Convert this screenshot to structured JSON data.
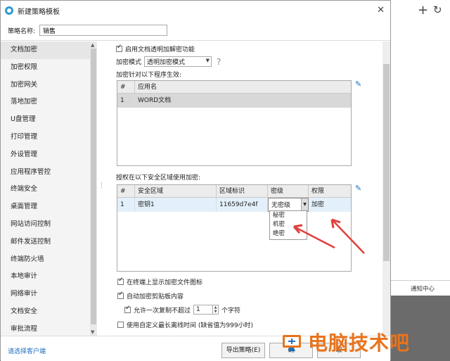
{
  "dialog": {
    "title": "新建策略模板",
    "close": "✕",
    "policy_name_label": "策略名称:",
    "policy_name_value": "销售"
  },
  "sidebar": {
    "items": [
      {
        "label": "文档加密"
      },
      {
        "label": "加密权限"
      },
      {
        "label": "加密网关"
      },
      {
        "label": "落地加密"
      },
      {
        "label": "U盘管理"
      },
      {
        "label": "打印管理"
      },
      {
        "label": "外设管理"
      },
      {
        "label": "应用程序管控"
      },
      {
        "label": "终端安全"
      },
      {
        "label": "桌面管理"
      },
      {
        "label": "网站访问控制"
      },
      {
        "label": "邮件发送控制"
      },
      {
        "label": "终端防火墙"
      },
      {
        "label": "本地审计"
      },
      {
        "label": "网络审计"
      },
      {
        "label": "文档安全"
      },
      {
        "label": "审批流程"
      }
    ]
  },
  "content": {
    "enable_transparent": "启用文档透明加解密功能",
    "encrypt_mode_label": "加密模式",
    "encrypt_mode_value": "透明加密模式",
    "question": "?",
    "programs_label": "加密针对以下程序生效:",
    "app_table": {
      "headers": [
        "#",
        "应用名"
      ],
      "rows": [
        {
          "num": "1",
          "name": "WORD文档"
        }
      ]
    },
    "zone_label": "授权在以下安全区域使用加密:",
    "zone_table": {
      "headers": [
        "#",
        "安全区域",
        "区域标识",
        "密级",
        "权限"
      ],
      "rows": [
        {
          "num": "1",
          "zone": "密钥1",
          "id": "11659d7e4f",
          "level": "无密级",
          "perm": "加密"
        }
      ]
    },
    "dropdown_options": [
      "秘密",
      "机密",
      "绝密"
    ],
    "show_icon": "在终端上显示加密文件图标",
    "auto_clipboard": "自动加密剪贴板内容",
    "allow_copy_prefix": "允许一次复制不超过",
    "allow_copy_value": "1",
    "allow_copy_suffix": "个字符",
    "custom_offline": "使用自定义最长离线时间 (缺省值为999小时)"
  },
  "bottom": {
    "select_client": "请选择客户端",
    "export": "导出策略(E)",
    "ok": "确",
    "cancel": "取"
  },
  "right_pane": {
    "plus": "+",
    "refresh": "↻",
    "notify": "通知中心"
  },
  "watermark": {
    "text": "电脑技术吧"
  },
  "colors": {
    "accent": "#1e6fbf",
    "annotation_arrow": "#e0403c",
    "watermark": "#e8731d"
  }
}
